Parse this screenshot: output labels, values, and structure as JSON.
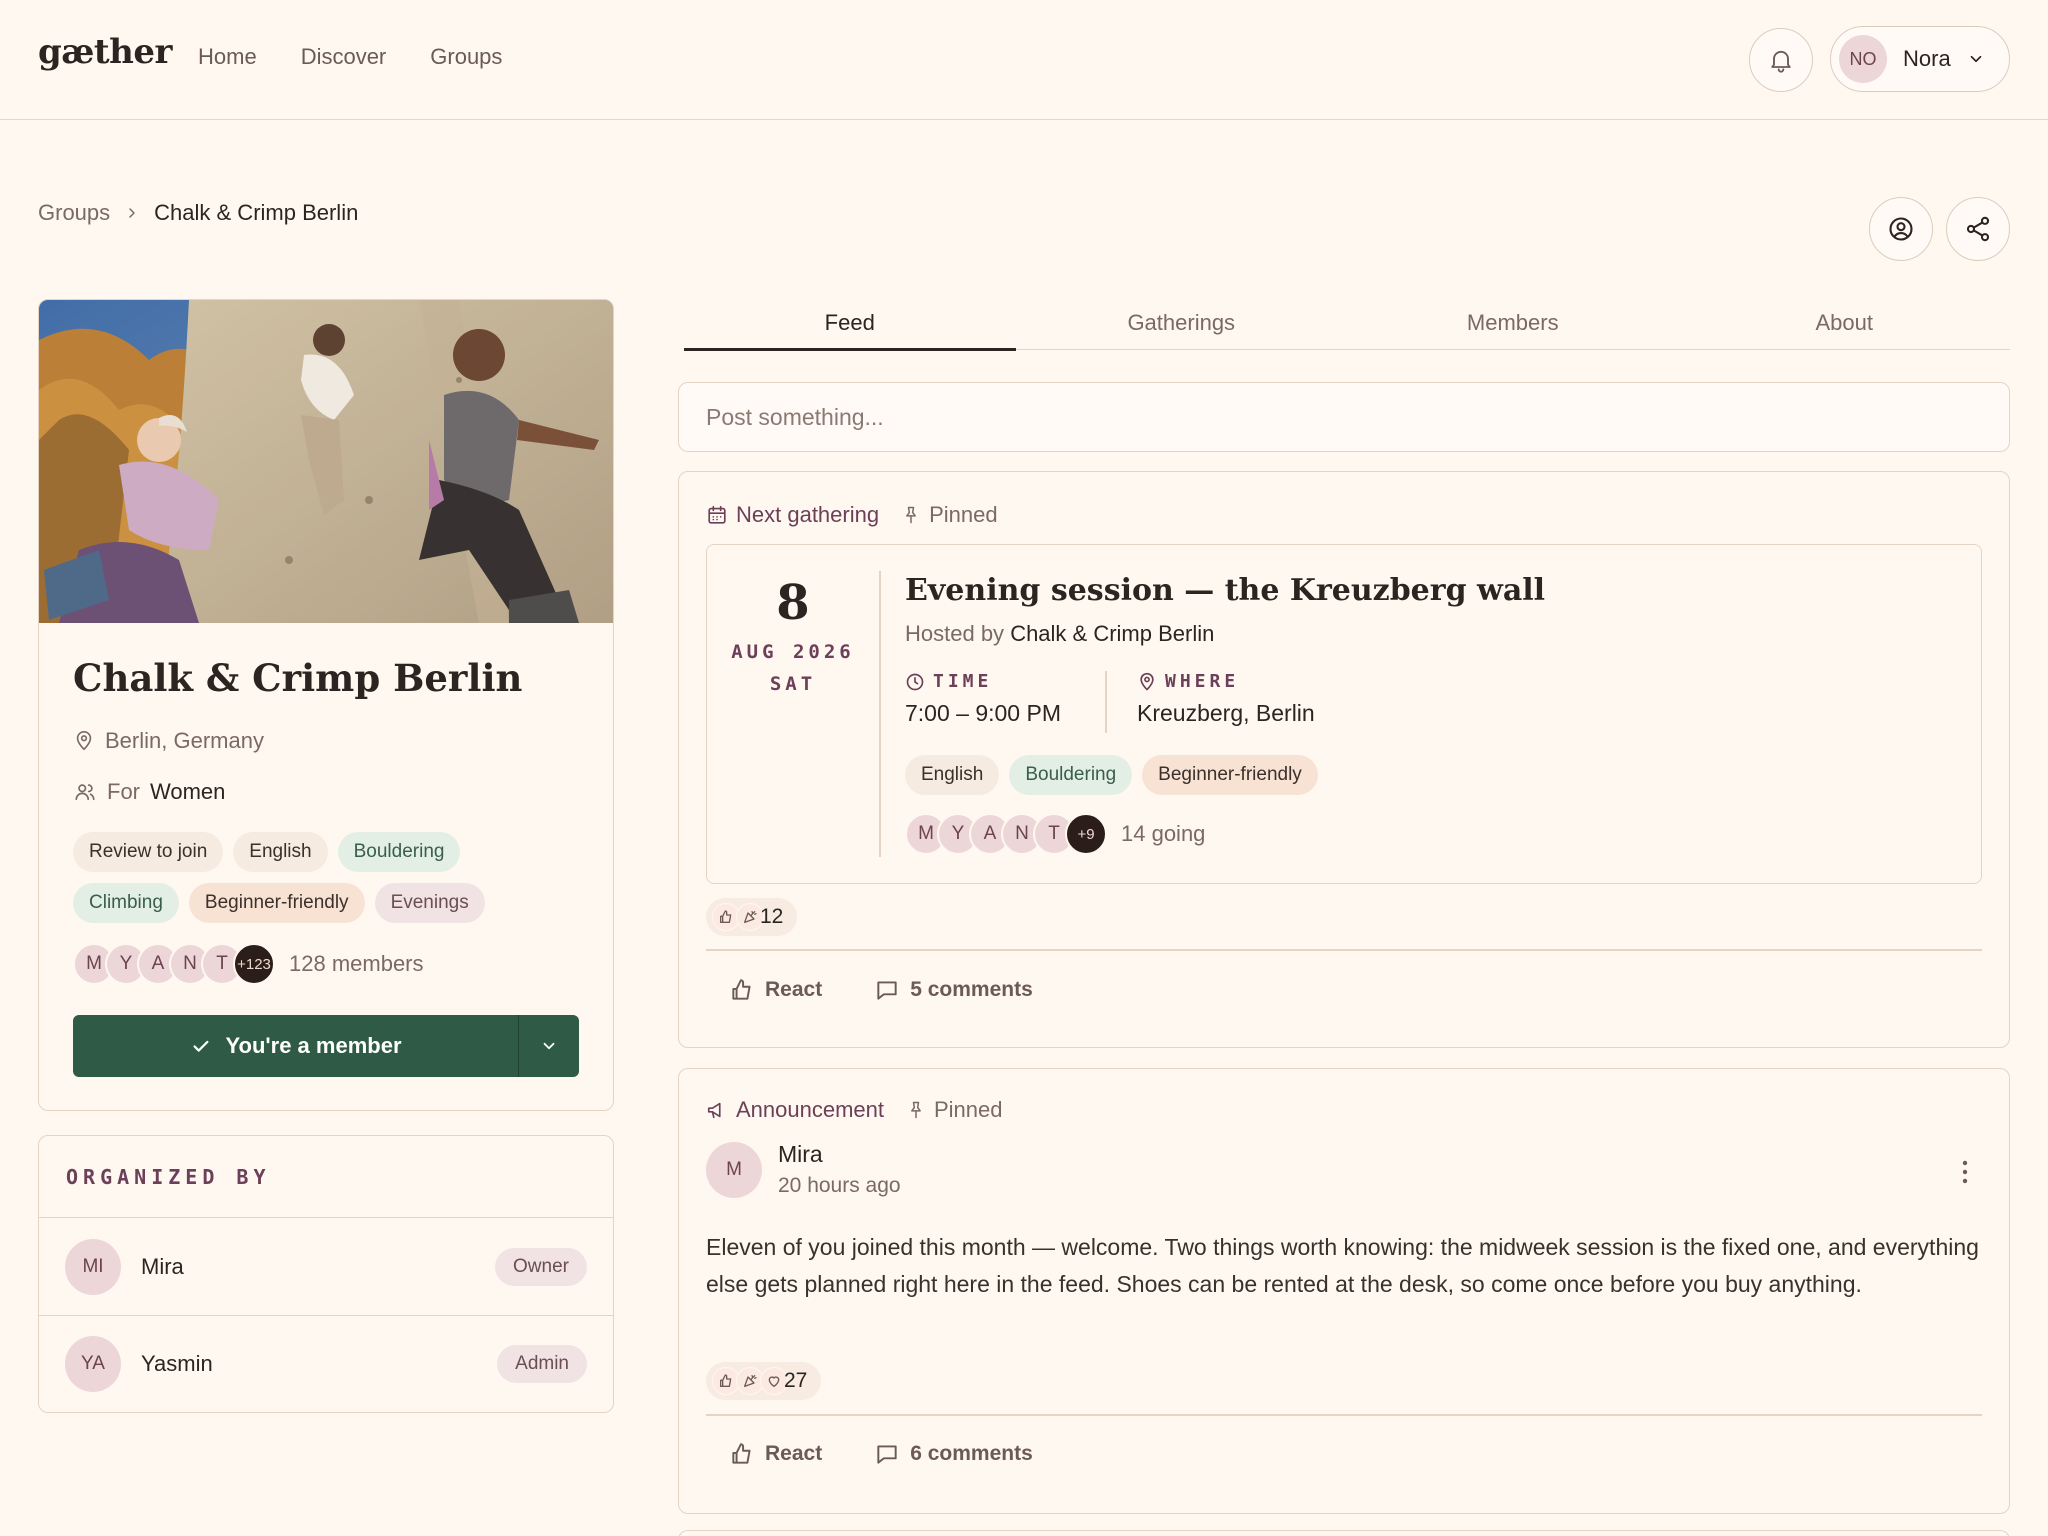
{
  "nav": {
    "logo": "gæther",
    "links": [
      "Home",
      "Discover",
      "Groups"
    ],
    "user_initials": "NO",
    "user_name": "Nora"
  },
  "breadcrumb": {
    "parent": "Groups",
    "current": "Chalk & Crimp Berlin"
  },
  "group": {
    "name": "Chalk & Crimp Berlin",
    "location": "Berlin, Germany",
    "for_label": "For",
    "for_value": "Women",
    "tags": [
      "Review to join",
      "English",
      "Bouldering",
      "Climbing",
      "Beginner-friendly",
      "Evenings"
    ],
    "member_initials": [
      "M",
      "Y",
      "A",
      "N",
      "T"
    ],
    "member_more": "+123",
    "member_count": "128 members",
    "member_button": "You're a member"
  },
  "organizers": {
    "heading": "ORGANIZED BY",
    "people": [
      {
        "initials": "MI",
        "name": "Mira",
        "role": "Owner"
      },
      {
        "initials": "YA",
        "name": "Yasmin",
        "role": "Admin"
      }
    ]
  },
  "tabs": [
    "Feed",
    "Gatherings",
    "Members",
    "About"
  ],
  "composer": {
    "placeholder": "Post something..."
  },
  "gathering_post": {
    "label": "Next gathering",
    "pinned": "Pinned",
    "day": "8",
    "month_year": "AUG 2026",
    "weekday": "SAT",
    "title": "Evening session — the Kreuzberg wall",
    "hosted_by": "Hosted by",
    "host": "Chalk & Crimp Berlin",
    "time_label": "TIME",
    "time_value": "7:00 – 9:00 PM",
    "where_label": "WHERE",
    "where_value": "Kreuzberg, Berlin",
    "tags": [
      "English",
      "Bouldering",
      "Beginner-friendly"
    ],
    "attendee_initials": [
      "M",
      "Y",
      "A",
      "N",
      "T"
    ],
    "attendee_more": "+9",
    "going": "14 going",
    "reactions": "12",
    "react": "React",
    "comments": "5 comments"
  },
  "announcement_post": {
    "label": "Announcement",
    "pinned": "Pinned",
    "author_initials": "M",
    "author": "Mira",
    "time": "20 hours ago",
    "body": "Eleven of you joined this month — welcome. Two things worth knowing: the midweek session is the fixed one, and everything else gets planned right here in the feed. Shoes can be rented at the desk, so come once before you buy anything.",
    "reactions": "27",
    "react": "React",
    "comments": "6 comments"
  },
  "colors": {
    "accent_green": "#2e5a46",
    "accent_plum": "#6b4058",
    "background": "#fff8f1"
  }
}
